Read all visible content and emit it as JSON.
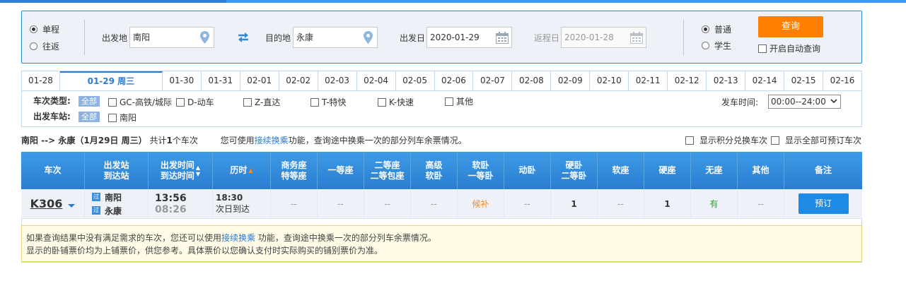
{
  "search": {
    "trip_types": [
      {
        "label": "单程",
        "selected": true
      },
      {
        "label": "往返",
        "selected": false
      }
    ],
    "from_label": "出发地",
    "from_value": "南阳",
    "to_label": "目的地",
    "to_value": "永康",
    "depart_label": "出发日",
    "depart_value": "2020-01-29",
    "return_label": "返程日",
    "return_value": "2020-01-28",
    "passenger_types": [
      {
        "label": "普通",
        "selected": true
      },
      {
        "label": "学生",
        "selected": false
      }
    ],
    "query_button": "查询",
    "auto_query_label": "开启自动查询"
  },
  "date_tabs": [
    "01-28",
    "01-29 周三",
    "01-30",
    "01-31",
    "02-01",
    "02-02",
    "02-03",
    "02-04",
    "02-05",
    "02-06",
    "02-07",
    "02-08",
    "02-09",
    "02-10",
    "02-11",
    "02-12",
    "02-13",
    "02-14",
    "02-15",
    "02-16"
  ],
  "active_tab": 1,
  "filters": {
    "train_type_label": "车次类型:",
    "all_label": "全部",
    "train_types": [
      "GC-高铁/城际",
      "D-动车",
      "Z-直达",
      "T-特快",
      "K-快速",
      "其他"
    ],
    "station_label": "出发车站:",
    "stations": [
      "南阳"
    ],
    "depart_time_label": "发车时间:",
    "depart_time_value": "00:00--24:00"
  },
  "summary": {
    "route": "南阳 --> 永康（1月29日  周三）",
    "count_prefix": "共计",
    "count": "1",
    "count_suffix": "个车次",
    "tip_prefix": "您可使用",
    "tip_link": "接续换乘",
    "tip_suffix": "功能，查询途中换乘一次的部分列车余票情况。",
    "option_points": "显示积分兑换车次",
    "option_all": "显示全部可预订车次"
  },
  "table": {
    "headers": [
      {
        "l1": "车次",
        "l2": ""
      },
      {
        "l1": "出发站",
        "l2": "到达站"
      },
      {
        "l1": "出发时间",
        "l2": "到达时间"
      },
      {
        "l1": "历时",
        "l2": ""
      },
      {
        "l1": "商务座",
        "l2": "特等座"
      },
      {
        "l1": "一等座",
        "l2": ""
      },
      {
        "l1": "二等座",
        "l2": "二等包座"
      },
      {
        "l1": "高级",
        "l2": "软卧"
      },
      {
        "l1": "软卧",
        "l2": "一等卧"
      },
      {
        "l1": "动卧",
        "l2": ""
      },
      {
        "l1": "硬卧",
        "l2": "二等卧"
      },
      {
        "l1": "软座",
        "l2": ""
      },
      {
        "l1": "硬座",
        "l2": ""
      },
      {
        "l1": "无座",
        "l2": ""
      },
      {
        "l1": "其他",
        "l2": ""
      },
      {
        "l1": "备注",
        "l2": ""
      }
    ],
    "rows": [
      {
        "train_no": "K306",
        "from_badge": "过",
        "from_station": "南阳",
        "to_badge": "过",
        "to_station": "永康",
        "depart_time": "13:56",
        "arrive_time": "08:26",
        "duration": "18:30",
        "arrive_day": "次日到达",
        "seats": [
          "--",
          "--",
          "--",
          "--",
          "候补",
          "--",
          "1",
          "--",
          "1",
          "有",
          "--"
        ],
        "book_label": "预订"
      }
    ]
  },
  "notice": {
    "line1_prefix": "如果查询结果中没有满足需求的车次，您还可以使用",
    "line1_link": "接续换乘",
    "line1_suffix": " 功能，查询途中换乘一次的部分列车余票情况。",
    "line2": "显示的卧铺票价均为上铺票价，供您参考。具体票价以您确认支付时实际购买的铺别票价为准。"
  },
  "colors": {
    "accent": "#2a7bd7",
    "query_button": "#ff8000",
    "table_header": "#3d9be6",
    "waitlist": "#f08c21",
    "available": "#32a032"
  }
}
